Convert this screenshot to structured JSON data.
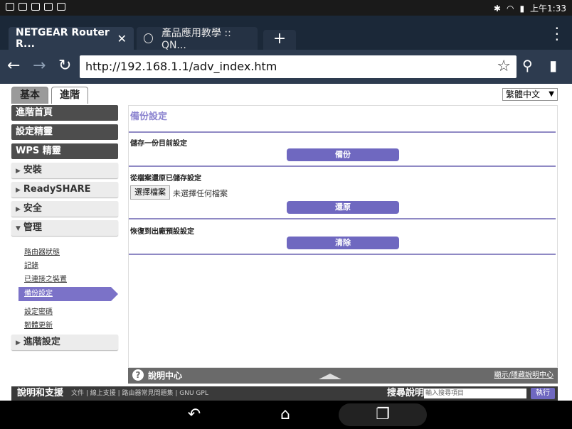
{
  "statusbar": {
    "time": "上午1:33"
  },
  "tabs": [
    {
      "title": "NETGEAR Router R..."
    },
    {
      "title": "產品應用教學 :: QN..."
    }
  ],
  "toolbar": {
    "url": "http://192.168.1.1/adv_index.htm"
  },
  "page": {
    "mode_tabs": {
      "basic": "基本",
      "advanced": "進階"
    },
    "language": "繁體中文",
    "sidebar": {
      "dark_items": [
        "進階首頁",
        "設定精靈",
        "WPS 精靈"
      ],
      "expand_items": [
        "安裝",
        "ReadySHARE",
        "安全",
        "管理"
      ],
      "sub_items": [
        "路由器狀態",
        "記錄",
        "已連接之裝置",
        "備份設定",
        "設定密碼",
        "韌體更新"
      ],
      "bottom_item": "進階設定"
    },
    "content": {
      "title": "備份設定",
      "backup_label": "儲存一份目前設定",
      "backup_button": "備份",
      "restore_label": "從檔案還原已儲存設定",
      "choose_file": "選擇檔案",
      "no_file": "未選擇任何檔案",
      "restore_button": "還原",
      "reset_label": "恢復到出廠預設設定",
      "reset_button": "清除"
    },
    "helpbar": {
      "label": "說明中心",
      "toggle": "顯示/隱藏說明中心"
    },
    "footer": {
      "title": "說明和支援",
      "links": "文件 | 線上支援 | 路由器常見問題集 | GNU GPL",
      "search_label": "搜尋說明",
      "search_placeholder": "輸入搜尋項目",
      "search_go": "執行"
    }
  }
}
